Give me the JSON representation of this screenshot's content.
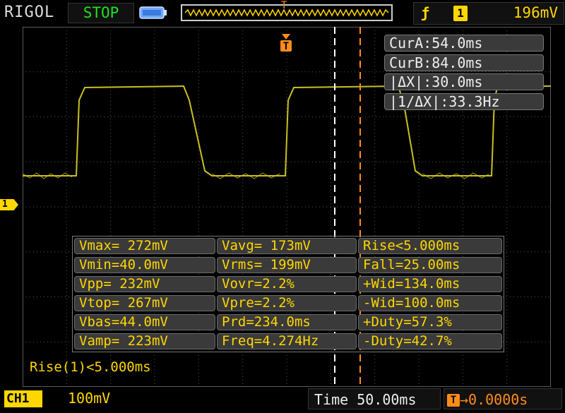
{
  "header": {
    "brand": "RIGOL",
    "run_status": "STOP",
    "trigger": {
      "edge_icon": "rising-edge-icon",
      "source": "1",
      "level": "196mV"
    },
    "trigger_position_marker": "T"
  },
  "channel_marker": "1",
  "trigger_marker": "T",
  "cursors": {
    "cur_a": "CurA:54.0ms",
    "cur_b": "CurB:84.0ms",
    "delta_x": "|ΔX|:30.0ms",
    "inv_delta_x": "|1/ΔX|:33.3Hz"
  },
  "measurements": {
    "rows": [
      [
        "Vmax= 272mV",
        "Vavg= 173mV",
        "Rise<5.000ms"
      ],
      [
        "Vmin=40.0mV",
        "Vrms= 199mV",
        "Fall=25.00ms"
      ],
      [
        "Vpp= 232mV",
        "Vovr=2.2%",
        "+Wid=134.0ms"
      ],
      [
        "Vtop= 267mV",
        "Vpre=2.2%",
        "-Wid=100.0ms"
      ],
      [
        "Vbas=44.0mV",
        "Prd=234.0ms",
        "+Duty=57.3%"
      ],
      [
        "Vamp= 223mV",
        "Freq=4.274Hz",
        "-Duty=42.7%"
      ]
    ],
    "status": "Rise(1)<5.000ms"
  },
  "footer": {
    "channel": "CH1",
    "scale": "100mV",
    "timebase": "Time 50.00ms",
    "trigger_offset": "0.0000s"
  },
  "colors": {
    "channel1": "#ffd700",
    "cursor_b": "#ff8c1a",
    "cursor_a": "#ffffff",
    "run_status": "#20e020",
    "waveform": "#c8c020",
    "grid": "#555555"
  }
}
